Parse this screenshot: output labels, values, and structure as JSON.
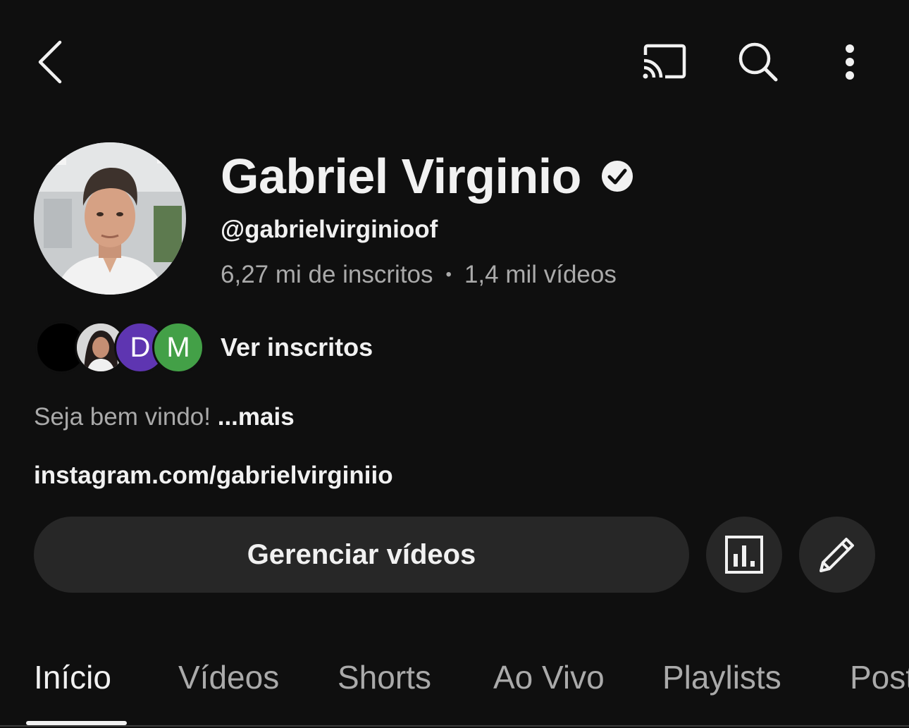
{
  "topbar": {
    "back_icon": "chevron-left-icon",
    "cast_icon": "cast-icon",
    "search_icon": "search-icon",
    "more_icon": "more-vertical-icon"
  },
  "channel": {
    "name": "Gabriel Virginio",
    "verified": true,
    "handle": "@gabrielvirginioof",
    "subscribers": "6,27 mi de inscritos",
    "separator": "•",
    "videos": "1,4 mil vídeos"
  },
  "subscribers_preview": {
    "avatars": [
      {
        "label": "",
        "color": "#000000"
      },
      {
        "label": "",
        "color": "#6b5a55"
      },
      {
        "label": "D",
        "color": "#5e35b1"
      },
      {
        "label": "M",
        "color": "#43a047"
      }
    ],
    "label": "Ver inscritos"
  },
  "description": {
    "text": "Seja bem vindo! ",
    "more": "...mais"
  },
  "link": "instagram.com/gabrielvirginiio",
  "actions": {
    "manage_label": "Gerenciar vídeos",
    "stats_icon": "analytics-icon",
    "edit_icon": "pencil-icon"
  },
  "tabs": [
    {
      "label": "Início",
      "active": true
    },
    {
      "label": "Vídeos",
      "active": false
    },
    {
      "label": "Shorts",
      "active": false
    },
    {
      "label": "Ao Vivo",
      "active": false
    },
    {
      "label": "Playlists",
      "active": false
    },
    {
      "label": "Posts",
      "active": false
    }
  ],
  "colors": {
    "background": "#0f0f0f",
    "button_bg": "#272727",
    "text_primary": "#f1f1f1",
    "text_secondary": "#aaaaaa"
  }
}
